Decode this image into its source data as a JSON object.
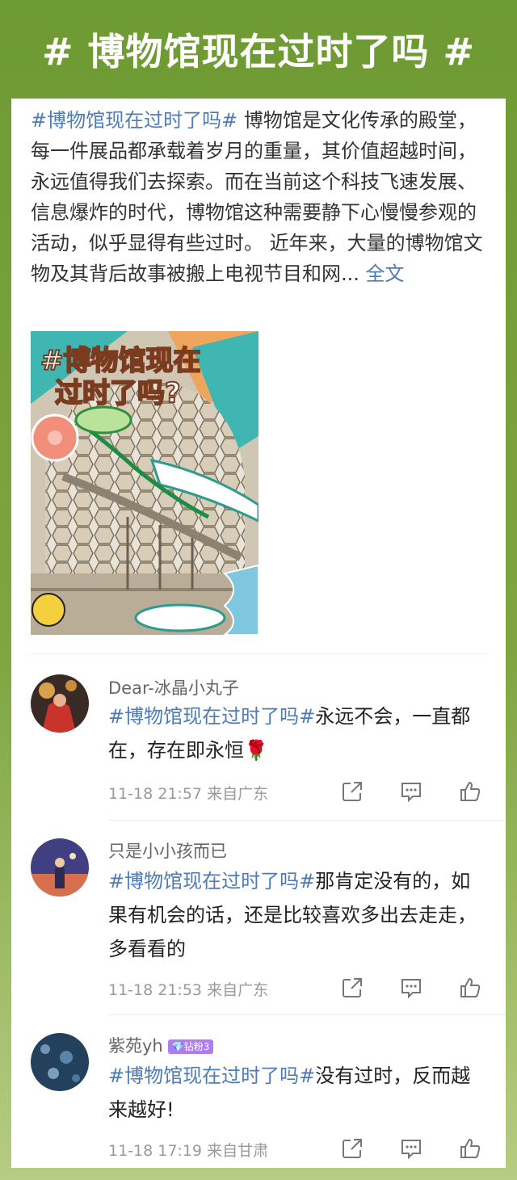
{
  "banner": {
    "title": "# 博物馆现在过时了吗 #"
  },
  "post": {
    "hashtag": "#博物馆现在过时了吗#",
    "body": " 博物馆是文化传承的殿堂，每一件展品都承载着岁月的重量，其价值超越时间，永远值得我们去探索。而在当前这个科技飞速发展、信息爆炸的时代，博物馆这种需要静下心慢慢参观的活动，似乎显得有些过时。 近年来，大量的博物馆文物及其背后故事被搬上电视节目和网...",
    "more_label": "全文",
    "image": {
      "title_line1": "#博物馆现在",
      "title_line2": "过时了吗?"
    }
  },
  "comments": [
    {
      "user": "Dear-冰晶小丸子",
      "badge": "",
      "hashtag": "#博物馆现在过时了吗#",
      "text": "永远不会，一直都在，存在即永恒🌹",
      "time": "11-18 21:57",
      "location": "来自广东",
      "avatar_color": "#b8322e"
    },
    {
      "user": "只是小小孩而已",
      "badge": "",
      "hashtag": "#博物馆现在过时了吗#",
      "text": "那肯定没有的，如果有机会的话，还是比较喜欢多出去走走，多看看的",
      "time": "11-18 21:53",
      "location": "来自广东",
      "avatar_color": "#4a4b8c"
    },
    {
      "user": "紫苑yh",
      "badge": "💎钻粉3",
      "hashtag": "#博物馆现在过时了吗#",
      "text": "没有过时，反而越来越好!",
      "time": "11-18 17:19",
      "location": "来自甘肃",
      "avatar_color": "#2d4c6a"
    }
  ],
  "icons": [
    "share-icon",
    "comment-icon",
    "like-icon"
  ],
  "colors": {
    "accent": "#4c7bb8",
    "banner_green": "#6e9a33"
  }
}
